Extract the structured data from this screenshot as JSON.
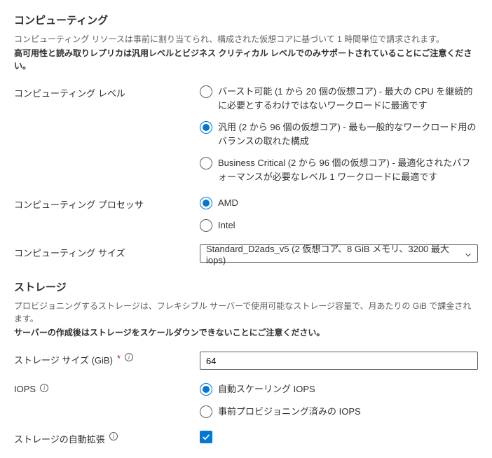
{
  "compute": {
    "title": "コンピューティング",
    "desc_line": "コンピューティング リソースは事前に割り当てられ、構成された仮想コアに基づいて 1 時間単位で請求されます。",
    "desc_bold": "高可用性と読み取りレプリカは汎用レベルとビジネス クリティカル レベルでのみサポートされていることにご注意ください。",
    "tier_label": "コンピューティング レベル",
    "tiers": [
      "バースト可能 (1 から 20 個の仮想コア) - 最大の CPU を継続的に必要とするわけではないワークロードに最適です",
      "汎用 (2 から 96 個の仮想コア) - 最も一般的なワークロード用のバランスの取れた構成",
      "Business Critical (2 から 96 個の仮想コア) - 最適化されたパフォーマンスが必要なレベル 1 ワークロードに最適です"
    ],
    "processor_label": "コンピューティング プロセッサ",
    "processors": [
      "AMD",
      "Intel"
    ],
    "size_label": "コンピューティング サイズ",
    "size_value": "Standard_D2ads_v5 (2 仮想コア、8 GiB メモリ、3200 最大 iops)"
  },
  "storage": {
    "title": "ストレージ",
    "desc_line": "プロビジョニングするストレージは、フレキシブル サーバーで使用可能なストレージ容量で、月あたりの GiB で課金されます。",
    "desc_bold": "サーバーの作成後はストレージをスケールダウンできないことにご注意ください。",
    "size_label": "ストレージ サイズ (GiB)",
    "size_value": "64",
    "iops_label": "IOPS",
    "iops_options": [
      "自動スケーリング IOPS",
      "事前プロビジョニング済みの IOPS"
    ],
    "autogrow_label": "ストレージの自動拡張"
  }
}
